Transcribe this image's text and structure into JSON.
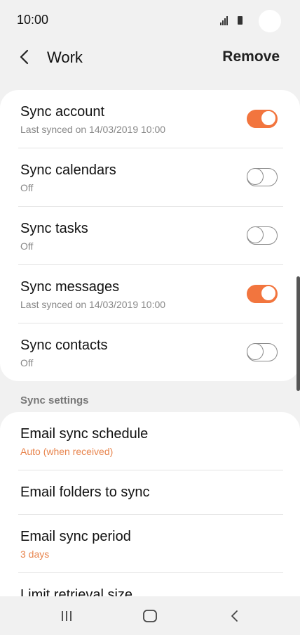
{
  "status_bar": {
    "time": "10:00",
    "icons": [
      "signal-icon",
      "battery-icon"
    ]
  },
  "app_bar": {
    "title": "Work",
    "back_icon": "chevron-left-icon",
    "remove_label": "Remove"
  },
  "sync_items": [
    {
      "title": "Sync account",
      "subtitle": "Last synced on 14/03/2019  10:00",
      "enabled": true
    },
    {
      "title": "Sync calendars",
      "subtitle": "Off",
      "enabled": false
    },
    {
      "title": "Sync tasks",
      "subtitle": "Off",
      "enabled": false
    },
    {
      "title": "Sync messages",
      "subtitle": "Last synced on 14/03/2019  10:00",
      "enabled": true
    },
    {
      "title": "Sync contacts",
      "subtitle": "Off",
      "enabled": false
    }
  ],
  "sync_settings": {
    "header": "Sync settings",
    "items": [
      {
        "title": "Email sync schedule",
        "subtitle": "Auto (when received)"
      },
      {
        "title": "Email folders to sync",
        "subtitle": ""
      },
      {
        "title": "Email sync period",
        "subtitle": "3 days"
      },
      {
        "title": "Limit retrieval size",
        "subtitle": ""
      }
    ]
  },
  "colors": {
    "accent": "#f2753e",
    "accent_text": "#e8854e",
    "background": "#f1f1f1"
  },
  "nav_bar": {
    "icons": [
      "recents-icon",
      "home-icon",
      "back-icon"
    ]
  }
}
